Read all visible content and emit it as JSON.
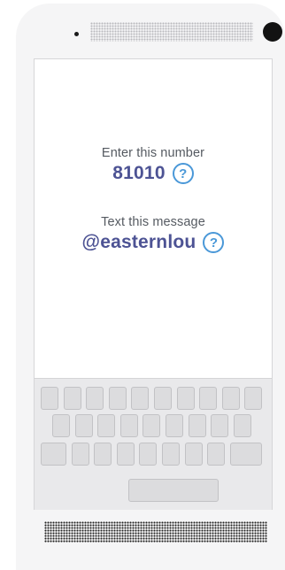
{
  "instructions": {
    "number_prompt": "Enter this number",
    "number": "81010",
    "message_prompt": "Text this message",
    "message": "@easternlou",
    "help_glyph": "?"
  },
  "colors": {
    "value_text": "#4d5394",
    "help_accent": "#4a98d8",
    "label_text": "#555a61"
  },
  "keyboard": {
    "rows": [
      10,
      9,
      9
    ],
    "has_space_bar": true
  }
}
